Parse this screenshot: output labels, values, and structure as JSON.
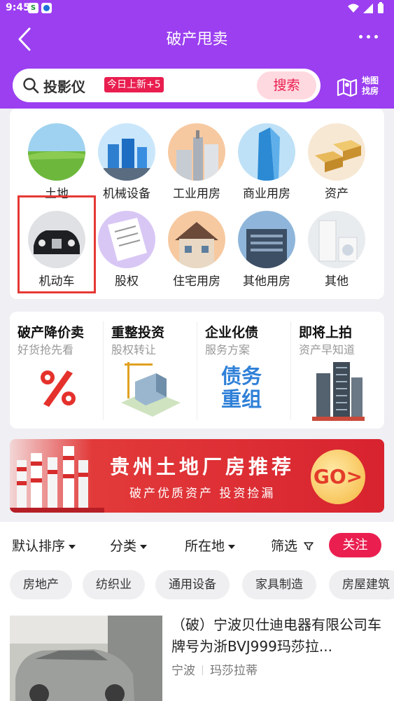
{
  "status_bar": {
    "time": "9:45",
    "app1_glyph": "S"
  },
  "nav": {
    "title": "破产甩卖"
  },
  "search": {
    "query": "投影仪",
    "tag": "今日上新+5",
    "button_label": "搜索"
  },
  "map_button": {
    "line1": "地图",
    "line2": "找房"
  },
  "categories": [
    {
      "label": "土地",
      "icon": "land-image"
    },
    {
      "label": "机械设备",
      "icon": "machinery-image"
    },
    {
      "label": "工业用房",
      "icon": "industrial-building-image"
    },
    {
      "label": "商业用房",
      "icon": "commercial-building-image"
    },
    {
      "label": "资产",
      "icon": "gold-bars-image"
    },
    {
      "label": "机动车",
      "icon": "car-image"
    },
    {
      "label": "股权",
      "icon": "contract-image"
    },
    {
      "label": "住宅用房",
      "icon": "house-image"
    },
    {
      "label": "其他用房",
      "icon": "other-building-image"
    },
    {
      "label": "其他",
      "icon": "appliances-image"
    }
  ],
  "services": [
    {
      "title": "破产降价卖",
      "subtitle": "好货抢先看",
      "icon": "percent-icon"
    },
    {
      "title": "重整投资",
      "subtitle": "股权转让",
      "icon": "construction-icon"
    },
    {
      "title": "企业化债",
      "subtitle": "服务方案",
      "icon_text_1": "债务",
      "icon_text_2": "重组"
    },
    {
      "title": "即将上拍",
      "subtitle": "资产早知道",
      "icon": "towers-icon"
    }
  ],
  "banner": {
    "title": "贵州土地厂房推荐",
    "subtitle": "破产优质资产 投资捡漏",
    "go_label": "GO>"
  },
  "filters": {
    "sort": "默认排序",
    "category": "分类",
    "location": "所在地",
    "filter": "筛选",
    "follow": "关注"
  },
  "chips": [
    "房地产",
    "纺织业",
    "通用设备",
    "家具制造",
    "房屋建筑"
  ],
  "listing": {
    "title": "（破）宁波贝仕迪电器有限公司车牌号为浙BVJ999玛莎拉...",
    "city": "宁波",
    "brand": "玛莎拉蒂"
  },
  "colors": {
    "header_purple": "#9b3ff0",
    "accent_red": "#e91e4f",
    "highlight_red": "#e53935"
  }
}
